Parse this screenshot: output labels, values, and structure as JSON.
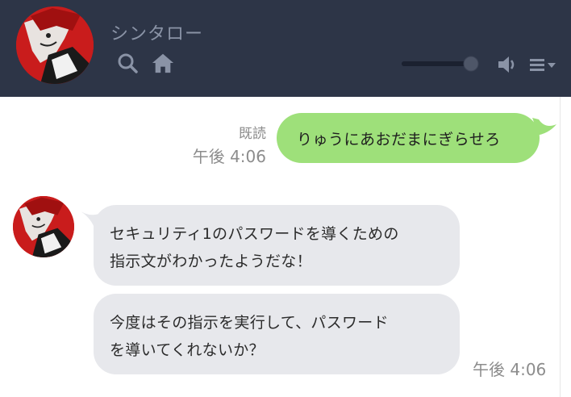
{
  "header": {
    "contact_name": "シンタロー",
    "icons": [
      "search-icon",
      "home-icon",
      "volume-icon",
      "menu-icon",
      "chevron-down-icon"
    ],
    "volume_level": 0.95,
    "background": "#2d3547"
  },
  "messages": {
    "outgoing": {
      "read_label": "既読",
      "time": "午後 4:06",
      "text": "りゅうにあおだまにぎらせろ",
      "bubble_color": "#9ee07a"
    },
    "incoming": {
      "lines_1": [
        "セキュリティ1のパスワードを導くための",
        "指示文がわかったようだな！"
      ],
      "lines_2": [
        "今度はその指示を実行して、パスワード",
        "を導いてくれないか？"
      ],
      "time": "午後 4:06",
      "bubble_color": "#e7e8ec"
    }
  }
}
